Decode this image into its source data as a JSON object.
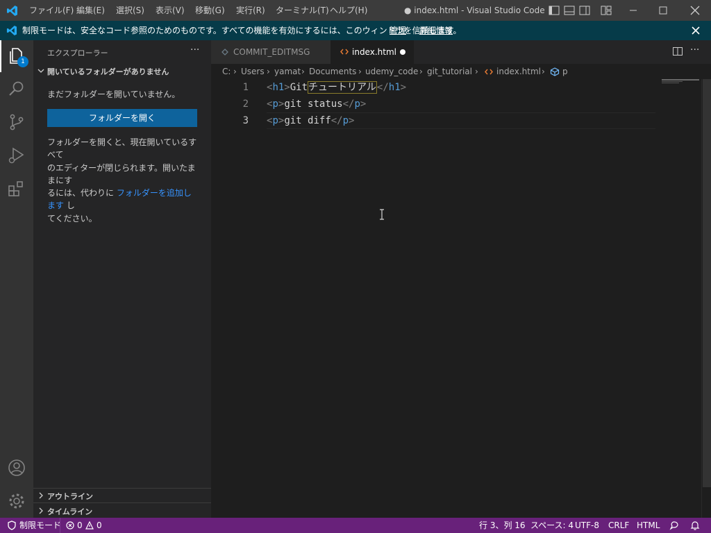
{
  "titlebar": {
    "menus": [
      "ファイル(F)",
      "編集(E)",
      "選択(S)",
      "表示(V)",
      "移動(G)",
      "実行(R)",
      "ターミナル(T)",
      "ヘルプ(H)"
    ],
    "window_title": "● index.html - Visual Studio Code"
  },
  "banner": {
    "message": "制限モードは、安全なコード参照のためのものです。すべての機能を有効にするには、このウィンドウを信頼します。",
    "manage": "管理",
    "details": "詳細情報"
  },
  "activitybar": {
    "explorer_badge": "1"
  },
  "sidebar": {
    "title": "エクスプローラー",
    "more": "···",
    "section_no_folder": "開いているフォルダーがありません",
    "no_folder_msg": "まだフォルダーを開いていません。",
    "open_folder_button": "フォルダーを開く",
    "desc_line1": "フォルダーを開くと、現在開いているすべて",
    "desc_line2": "のエディターが閉じられます。開いたままにす",
    "desc_line3a": "るには、代わりに ",
    "desc_link": "フォルダーを追加します",
    "desc_line3b": " し",
    "desc_line4": "てください。",
    "section_outline": "アウトライン",
    "section_timeline": "タイムライン"
  },
  "tabs": [
    {
      "label": "COMMIT_EDITMSG",
      "active": false
    },
    {
      "label": "index.html",
      "active": true,
      "dirty": true
    }
  ],
  "breadcrumb": [
    "C:",
    "Users",
    "yamat",
    "Documents",
    "udemy_code",
    "git_tutorial",
    "index.html",
    "p"
  ],
  "editor": {
    "lines": [
      {
        "number": "1",
        "tag": "h1",
        "text_a": "Git",
        "text_b": "チュートリアル"
      },
      {
        "number": "2",
        "tag": "p",
        "text": "git status"
      },
      {
        "number": "3",
        "tag": "p",
        "text": "git diff"
      }
    ]
  },
  "statusbar": {
    "restricted": "制限モード",
    "errors": "0",
    "warnings": "0",
    "position": "行 3、列 16",
    "spaces": "スペース: 4",
    "encoding": "UTF-8",
    "eol": "CRLF",
    "language": "HTML"
  },
  "colors": {
    "titlebar_bg": "#3c3c3c",
    "banner_bg": "#063b49",
    "statusbar_bg": "#68217a",
    "button_bg": "#0e639c",
    "accent_badge": "#007acc"
  },
  "icons": [
    "vscode-logo-icon",
    "explorer-icon",
    "search-icon",
    "source-control-icon",
    "run-debug-icon",
    "extensions-icon",
    "account-icon",
    "settings-gear-icon",
    "split-editor-icon",
    "bell-icon"
  ]
}
